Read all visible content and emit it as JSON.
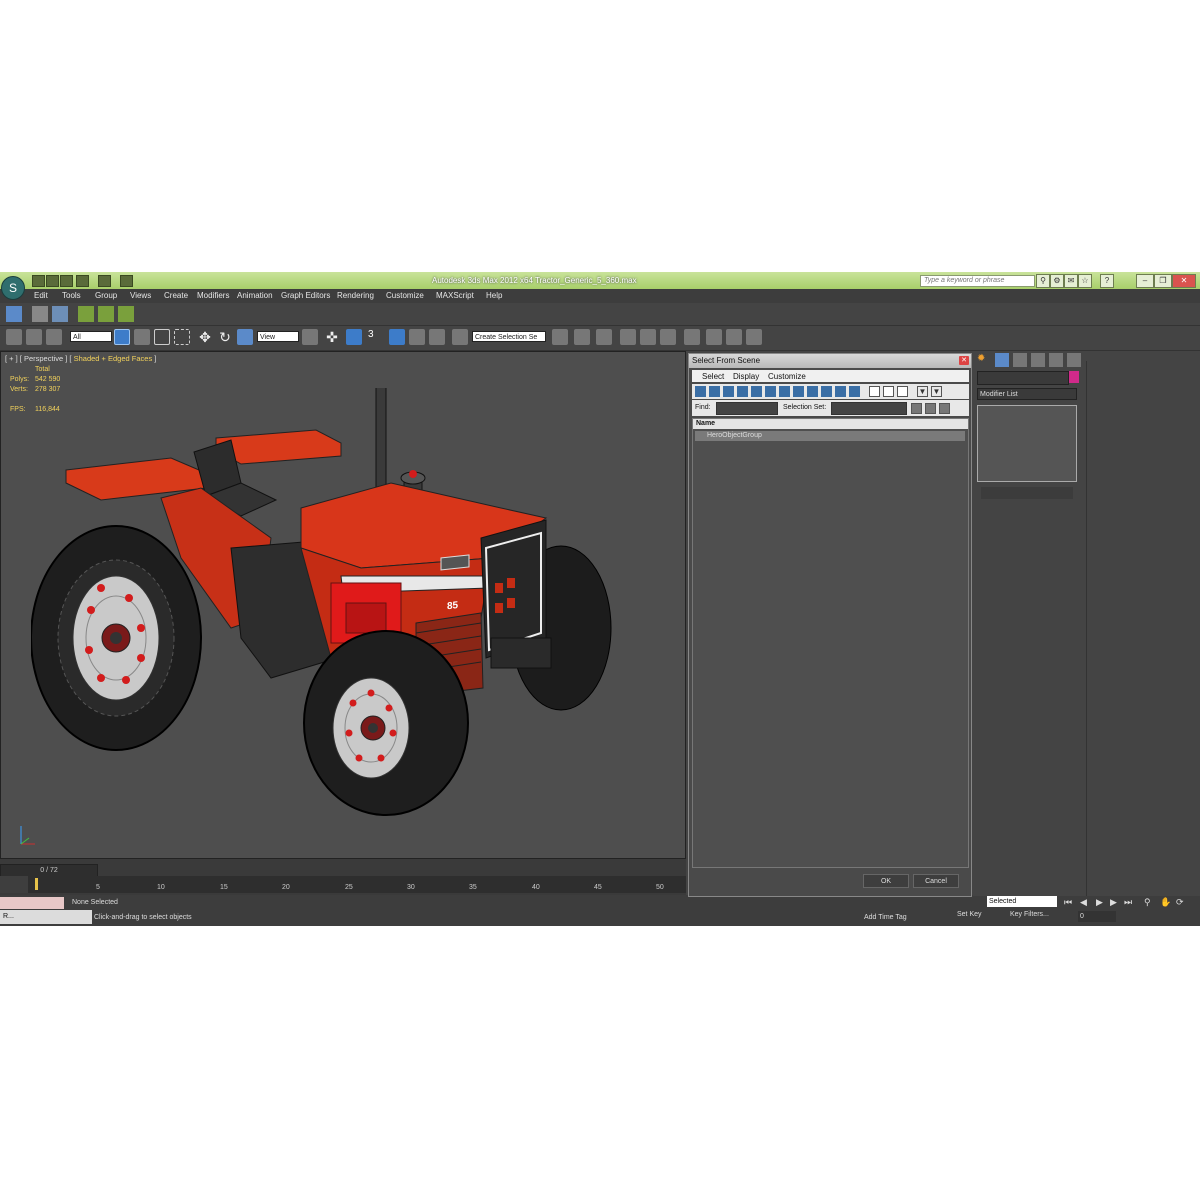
{
  "app": {
    "title": "Autodesk 3ds Max  2012 x64     Tractor_Generic_5_360.max",
    "search_placeholder": "Type a keyword or phrase"
  },
  "menu": [
    "Edit",
    "Tools",
    "Group",
    "Views",
    "Create",
    "Modifiers",
    "Animation",
    "Graph Editors",
    "Rendering",
    "Customize",
    "MAXScript",
    "Help"
  ],
  "toolbar": {
    "filter_value": "All",
    "ref_coord_value": "View",
    "snap_label": "3",
    "selection_set_value": "Create Selection Se"
  },
  "viewport": {
    "label_prefix": "[ + ] [ Perspective ] [",
    "label_shading": "Shaded + Edged Faces",
    "label_suffix": "]",
    "stats_header": "Total",
    "polys_label": "Polys:",
    "polys_value": "542 590",
    "verts_label": "Verts:",
    "verts_value": "278 307",
    "fps_label": "FPS:",
    "fps_value": "116,844",
    "tractor_badge": "85"
  },
  "timeline": {
    "slider": "0 / 72",
    "ticks": [
      "5",
      "10",
      "15",
      "20",
      "25",
      "30",
      "35",
      "40",
      "45",
      "50"
    ]
  },
  "status": {
    "selected_text": "None Selected",
    "prompt": "Click-and-drag to select objects",
    "add_time_tag": "Add Time Tag",
    "set_key": "Set Key",
    "key_filters": "Key Filters...",
    "selected_dropdown": "Selected",
    "frame_value": "0",
    "taskbar_label": "R..."
  },
  "command_panel": {
    "modifier_list": "Modifier List"
  },
  "dialog": {
    "title": "Select From Scene",
    "menu": [
      "Select",
      "Display",
      "Customize"
    ],
    "find_label": "Find:",
    "selection_set_label": "Selection Set:",
    "column_name": "Name",
    "rows": [
      "HeroObjectGroup"
    ],
    "ok": "OK",
    "cancel": "Cancel"
  }
}
